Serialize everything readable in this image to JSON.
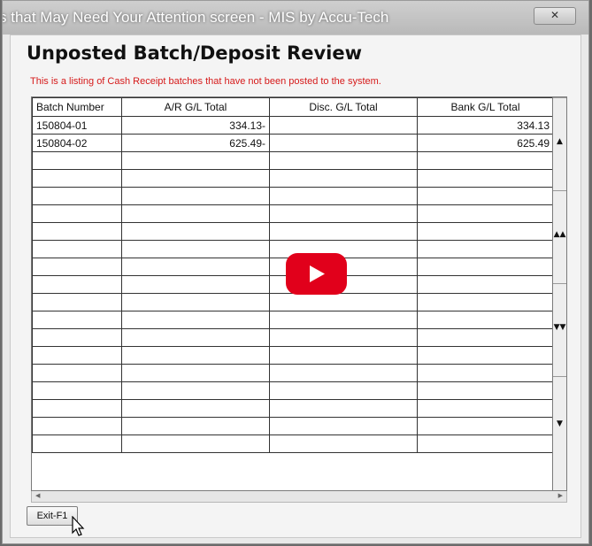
{
  "video": {
    "title": "s that May Need Your Attention screen - MIS by Accu-Tech"
  },
  "window": {
    "close_label": "✕"
  },
  "screen": {
    "heading": "Unposted Batch/Deposit Review",
    "subtitle": "This is a listing of Cash Receipt batches that have not been posted to the system."
  },
  "grid": {
    "columns": [
      "Batch Number",
      "A/R G/L Total",
      "Disc. G/L Total",
      "Bank G/L Total"
    ],
    "rows": [
      [
        "150804-01",
        "334.13-",
        "",
        "334.13"
      ],
      [
        "150804-02",
        "625.49-",
        "",
        "625.49"
      ]
    ],
    "empty_rows": 17
  },
  "scrollbar": {
    "up_label": "▲",
    "page_up_label": "▲▲",
    "page_down_label": "▼▼",
    "down_label": "▼",
    "left_label": "◀",
    "right_label": "▶"
  },
  "footer": {
    "exit_label": "Exit-F1"
  },
  "colors": {
    "subtitle": "#d61a1a",
    "play_button": "#e1001b"
  }
}
